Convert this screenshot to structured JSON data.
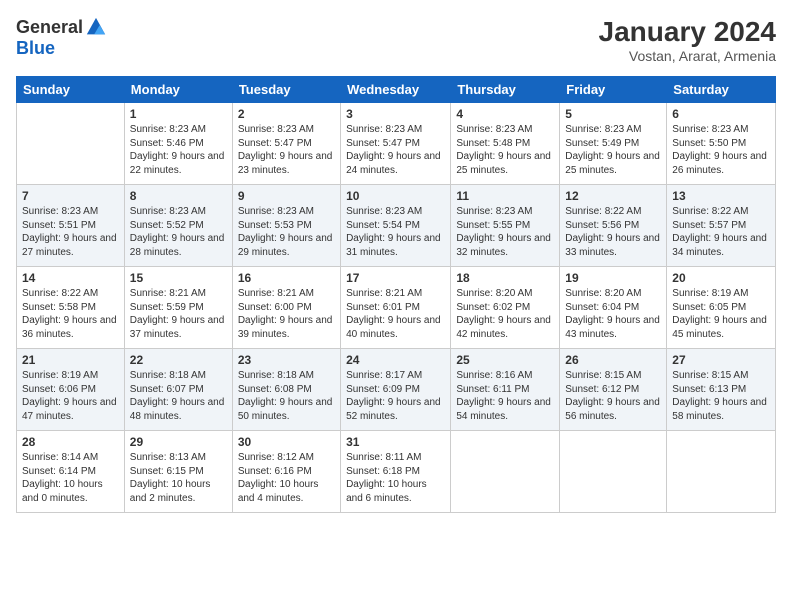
{
  "header": {
    "logo_general": "General",
    "logo_blue": "Blue",
    "month_year": "January 2024",
    "location": "Vostan, Ararat, Armenia"
  },
  "weekdays": [
    "Sunday",
    "Monday",
    "Tuesday",
    "Wednesday",
    "Thursday",
    "Friday",
    "Saturday"
  ],
  "weeks": [
    [
      {
        "day": "",
        "sunrise": "",
        "sunset": "",
        "daylight": ""
      },
      {
        "day": "1",
        "sunrise": "Sunrise: 8:23 AM",
        "sunset": "Sunset: 5:46 PM",
        "daylight": "Daylight: 9 hours and 22 minutes."
      },
      {
        "day": "2",
        "sunrise": "Sunrise: 8:23 AM",
        "sunset": "Sunset: 5:47 PM",
        "daylight": "Daylight: 9 hours and 23 minutes."
      },
      {
        "day": "3",
        "sunrise": "Sunrise: 8:23 AM",
        "sunset": "Sunset: 5:47 PM",
        "daylight": "Daylight: 9 hours and 24 minutes."
      },
      {
        "day": "4",
        "sunrise": "Sunrise: 8:23 AM",
        "sunset": "Sunset: 5:48 PM",
        "daylight": "Daylight: 9 hours and 25 minutes."
      },
      {
        "day": "5",
        "sunrise": "Sunrise: 8:23 AM",
        "sunset": "Sunset: 5:49 PM",
        "daylight": "Daylight: 9 hours and 25 minutes."
      },
      {
        "day": "6",
        "sunrise": "Sunrise: 8:23 AM",
        "sunset": "Sunset: 5:50 PM",
        "daylight": "Daylight: 9 hours and 26 minutes."
      }
    ],
    [
      {
        "day": "7",
        "sunrise": "Sunrise: 8:23 AM",
        "sunset": "Sunset: 5:51 PM",
        "daylight": "Daylight: 9 hours and 27 minutes."
      },
      {
        "day": "8",
        "sunrise": "Sunrise: 8:23 AM",
        "sunset": "Sunset: 5:52 PM",
        "daylight": "Daylight: 9 hours and 28 minutes."
      },
      {
        "day": "9",
        "sunrise": "Sunrise: 8:23 AM",
        "sunset": "Sunset: 5:53 PM",
        "daylight": "Daylight: 9 hours and 29 minutes."
      },
      {
        "day": "10",
        "sunrise": "Sunrise: 8:23 AM",
        "sunset": "Sunset: 5:54 PM",
        "daylight": "Daylight: 9 hours and 31 minutes."
      },
      {
        "day": "11",
        "sunrise": "Sunrise: 8:23 AM",
        "sunset": "Sunset: 5:55 PM",
        "daylight": "Daylight: 9 hours and 32 minutes."
      },
      {
        "day": "12",
        "sunrise": "Sunrise: 8:22 AM",
        "sunset": "Sunset: 5:56 PM",
        "daylight": "Daylight: 9 hours and 33 minutes."
      },
      {
        "day": "13",
        "sunrise": "Sunrise: 8:22 AM",
        "sunset": "Sunset: 5:57 PM",
        "daylight": "Daylight: 9 hours and 34 minutes."
      }
    ],
    [
      {
        "day": "14",
        "sunrise": "Sunrise: 8:22 AM",
        "sunset": "Sunset: 5:58 PM",
        "daylight": "Daylight: 9 hours and 36 minutes."
      },
      {
        "day": "15",
        "sunrise": "Sunrise: 8:21 AM",
        "sunset": "Sunset: 5:59 PM",
        "daylight": "Daylight: 9 hours and 37 minutes."
      },
      {
        "day": "16",
        "sunrise": "Sunrise: 8:21 AM",
        "sunset": "Sunset: 6:00 PM",
        "daylight": "Daylight: 9 hours and 39 minutes."
      },
      {
        "day": "17",
        "sunrise": "Sunrise: 8:21 AM",
        "sunset": "Sunset: 6:01 PM",
        "daylight": "Daylight: 9 hours and 40 minutes."
      },
      {
        "day": "18",
        "sunrise": "Sunrise: 8:20 AM",
        "sunset": "Sunset: 6:02 PM",
        "daylight": "Daylight: 9 hours and 42 minutes."
      },
      {
        "day": "19",
        "sunrise": "Sunrise: 8:20 AM",
        "sunset": "Sunset: 6:04 PM",
        "daylight": "Daylight: 9 hours and 43 minutes."
      },
      {
        "day": "20",
        "sunrise": "Sunrise: 8:19 AM",
        "sunset": "Sunset: 6:05 PM",
        "daylight": "Daylight: 9 hours and 45 minutes."
      }
    ],
    [
      {
        "day": "21",
        "sunrise": "Sunrise: 8:19 AM",
        "sunset": "Sunset: 6:06 PM",
        "daylight": "Daylight: 9 hours and 47 minutes."
      },
      {
        "day": "22",
        "sunrise": "Sunrise: 8:18 AM",
        "sunset": "Sunset: 6:07 PM",
        "daylight": "Daylight: 9 hours and 48 minutes."
      },
      {
        "day": "23",
        "sunrise": "Sunrise: 8:18 AM",
        "sunset": "Sunset: 6:08 PM",
        "daylight": "Daylight: 9 hours and 50 minutes."
      },
      {
        "day": "24",
        "sunrise": "Sunrise: 8:17 AM",
        "sunset": "Sunset: 6:09 PM",
        "daylight": "Daylight: 9 hours and 52 minutes."
      },
      {
        "day": "25",
        "sunrise": "Sunrise: 8:16 AM",
        "sunset": "Sunset: 6:11 PM",
        "daylight": "Daylight: 9 hours and 54 minutes."
      },
      {
        "day": "26",
        "sunrise": "Sunrise: 8:15 AM",
        "sunset": "Sunset: 6:12 PM",
        "daylight": "Daylight: 9 hours and 56 minutes."
      },
      {
        "day": "27",
        "sunrise": "Sunrise: 8:15 AM",
        "sunset": "Sunset: 6:13 PM",
        "daylight": "Daylight: 9 hours and 58 minutes."
      }
    ],
    [
      {
        "day": "28",
        "sunrise": "Sunrise: 8:14 AM",
        "sunset": "Sunset: 6:14 PM",
        "daylight": "Daylight: 10 hours and 0 minutes."
      },
      {
        "day": "29",
        "sunrise": "Sunrise: 8:13 AM",
        "sunset": "Sunset: 6:15 PM",
        "daylight": "Daylight: 10 hours and 2 minutes."
      },
      {
        "day": "30",
        "sunrise": "Sunrise: 8:12 AM",
        "sunset": "Sunset: 6:16 PM",
        "daylight": "Daylight: 10 hours and 4 minutes."
      },
      {
        "day": "31",
        "sunrise": "Sunrise: 8:11 AM",
        "sunset": "Sunset: 6:18 PM",
        "daylight": "Daylight: 10 hours and 6 minutes."
      },
      {
        "day": "",
        "sunrise": "",
        "sunset": "",
        "daylight": ""
      },
      {
        "day": "",
        "sunrise": "",
        "sunset": "",
        "daylight": ""
      },
      {
        "day": "",
        "sunrise": "",
        "sunset": "",
        "daylight": ""
      }
    ]
  ]
}
